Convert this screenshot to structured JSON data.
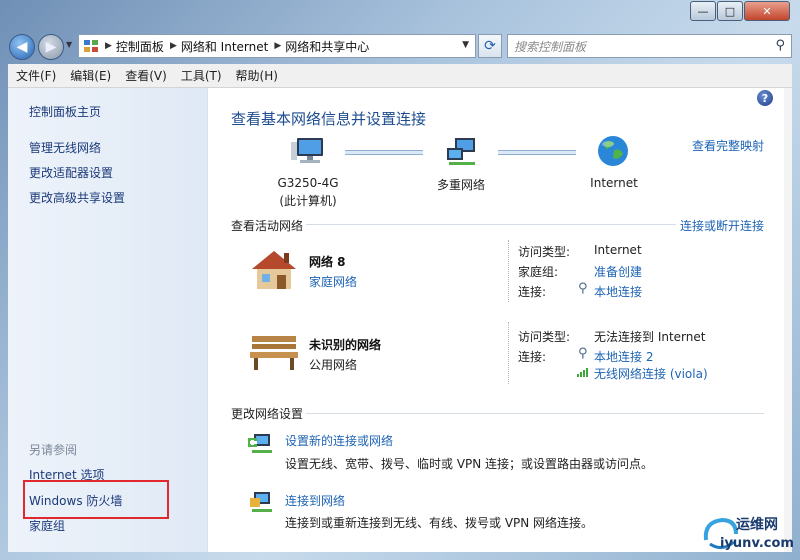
{
  "window": {
    "minimize": "—",
    "maximize": "□",
    "close": "✕"
  },
  "address": {
    "crumbs": [
      "控制面板",
      "网络和 Internet",
      "网络和共享中心"
    ],
    "search_placeholder": "搜索控制面板"
  },
  "menu": [
    "文件(F)",
    "编辑(E)",
    "查看(V)",
    "工具(T)",
    "帮助(H)"
  ],
  "sidebar": {
    "items": [
      "控制面板主页",
      "管理无线网络",
      "更改适配器设置",
      "更改高级共享设置"
    ],
    "see_also_heading": "另请参阅",
    "see_also": [
      "Internet 选项",
      "Windows 防火墙",
      "家庭组"
    ]
  },
  "main": {
    "title": "查看基本网络信息并设置连接",
    "full_map_link": "查看完整映射",
    "map": {
      "computer_name": "G3250-4G",
      "computer_sub": "(此计算机)",
      "multi_network": "多重网络",
      "internet": "Internet"
    },
    "active_heading": "查看活动网络",
    "connect_link": "连接或断开连接",
    "networks": [
      {
        "name": "网络  8",
        "type": "家庭网络",
        "access_type_label": "访问类型:",
        "access_type": "Internet",
        "homegroup_label": "家庭组:",
        "homegroup": "准备创建",
        "connections_label": "连接:",
        "connections": [
          "本地连接"
        ]
      },
      {
        "name": "未识别的网络",
        "type": "公用网络",
        "access_type_label": "访问类型:",
        "access_type": "无法连接到 Internet",
        "connections_label": "连接:",
        "connections": [
          "本地连接 2",
          "无线网络连接 (viola)"
        ]
      }
    ],
    "change_heading": "更改网络设置",
    "tasks": [
      {
        "link": "设置新的连接或网络",
        "desc": "设置无线、宽带、拨号、临时或 VPN 连接；或设置路由器或访问点。"
      },
      {
        "link": "连接到网络",
        "desc": "连接到或重新连接到无线、有线、拨号或 VPN 网络连接。"
      }
    ]
  },
  "watermark": {
    "line1": "运维网",
    "line2": "iyunv.com"
  },
  "colors": {
    "link": "#1e64b4",
    "title": "#1e4c8f",
    "highlight_box": "#e0282d"
  }
}
